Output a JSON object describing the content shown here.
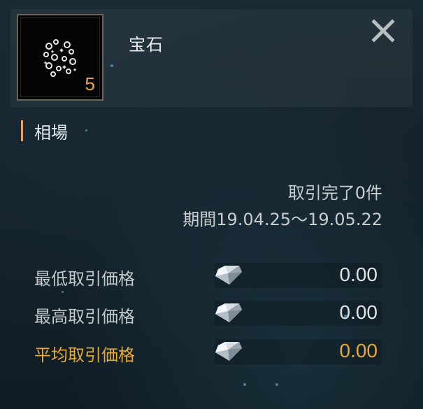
{
  "item": {
    "name": "宝石",
    "count": "5",
    "icon": "gem-fragments-icon"
  },
  "section": {
    "title": "相場"
  },
  "summary": {
    "trade_count": "取引完了0件",
    "period": "期間19.04.25～19.05.22"
  },
  "prices": [
    {
      "label": "最低取引価格",
      "value": "0.00",
      "icon": "diamond-icon"
    },
    {
      "label": "最高取引価格",
      "value": "0.00",
      "icon": "diamond-icon"
    },
    {
      "label": "平均取引価格",
      "value": "0.00",
      "icon": "diamond-icon"
    }
  ],
  "colors": {
    "accent": "#e7a83a",
    "section_bar": "#e8a06a"
  }
}
